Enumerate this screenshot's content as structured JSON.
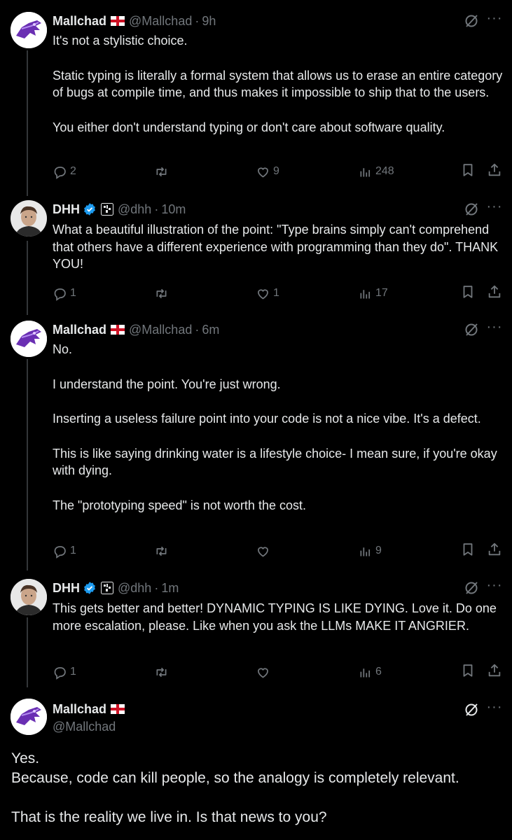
{
  "tweets": [
    {
      "name": "Mallchad",
      "handle": "@Mallchad",
      "time": "9h",
      "paragraphs": [
        "It's not a stylistic choice.",
        "Static typing is literally a formal system that allows us to erase an entire category of bugs at compile time, and thus makes it impossible to ship that to the users.",
        "You either don't understand typing or don't care about software quality."
      ],
      "replies": "2",
      "retweets": "",
      "likes": "9",
      "views": "248"
    },
    {
      "name": "DHH",
      "handle": "@dhh",
      "time": "10m",
      "paragraphs": [
        "What a beautiful illustration of the point: \"Type brains simply can't comprehend that others have a different experience with programming than they do\". THANK YOU!"
      ],
      "replies": "1",
      "retweets": "",
      "likes": "1",
      "views": "17"
    },
    {
      "name": "Mallchad",
      "handle": "@Mallchad",
      "time": "6m",
      "paragraphs": [
        "No.",
        "I understand the point. You're just wrong.",
        "Inserting a useless failure point into your code is not a nice vibe. It's a defect.",
        "This is like saying drinking water is a lifestyle choice- I mean sure, if you're okay with dying.",
        "The \"prototyping speed\" is not worth the cost."
      ],
      "replies": "1",
      "retweets": "",
      "likes": "",
      "views": "9"
    },
    {
      "name": "DHH",
      "handle": "@dhh",
      "time": "1m",
      "paragraphs": [
        "This gets better and better! DYNAMIC TYPING IS LIKE DYING. Love it. Do one more escalation, please. Like when you ask the LLMs MAKE IT ANGRIER."
      ],
      "replies": "1",
      "retweets": "",
      "likes": "",
      "views": "6"
    }
  ],
  "main_tweet": {
    "name": "Mallchad",
    "handle": "@Mallchad",
    "lines": [
      "Yes.",
      "Because, code can kill people, so the analogy is completely relevant.",
      "That is the reality we live in. Is that news to you?"
    ]
  },
  "separator": "·",
  "more_label": "···",
  "colors": {
    "background": "#000000",
    "text": "#e7e9ea",
    "muted": "#71767b",
    "verified": "#1d9bf0"
  },
  "icons": [
    "reply-icon",
    "retweet-icon",
    "like-icon",
    "views-icon",
    "bookmark-icon",
    "share-icon",
    "grok-icon",
    "more-icon",
    "verified-icon",
    "england-flag-icon",
    "affiliate-icon"
  ]
}
